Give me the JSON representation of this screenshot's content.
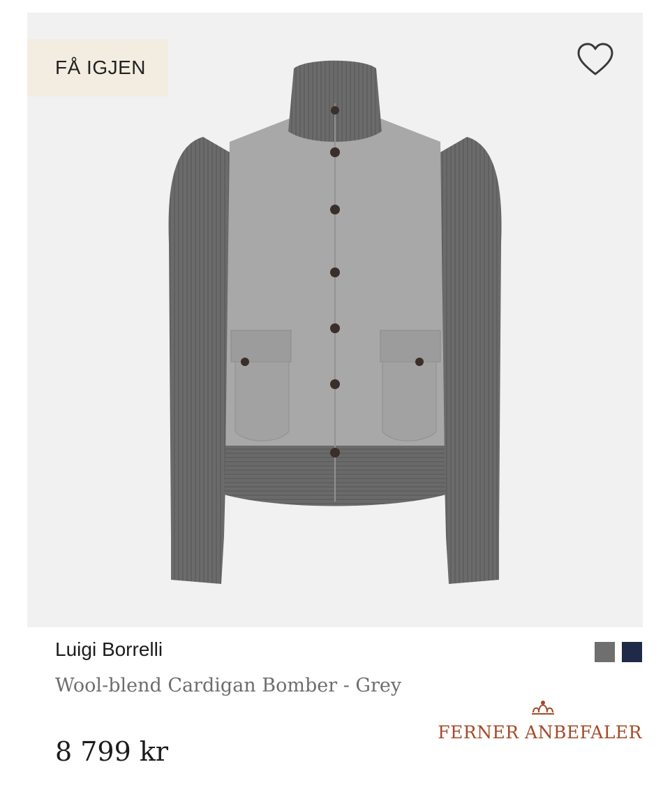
{
  "product": {
    "badge_label": "FÅ IGJEN",
    "image_alt": "Wool-blend Cardigan Bomber - Grey",
    "brand": "Luigi Borrelli",
    "title": "Wool-blend Cardigan Bomber - Grey",
    "price": "8 799 kr"
  },
  "swatches": [
    {
      "name": "grey",
      "color": "#6f6f6f"
    },
    {
      "name": "navy",
      "color": "#1e2a47"
    }
  ],
  "recommendation": {
    "label": "FERNER ANBEFALER",
    "color": "#a54a28"
  },
  "icons": {
    "wishlist": "heart-outline-icon",
    "ferner_logo": "crown-ornament-icon"
  }
}
